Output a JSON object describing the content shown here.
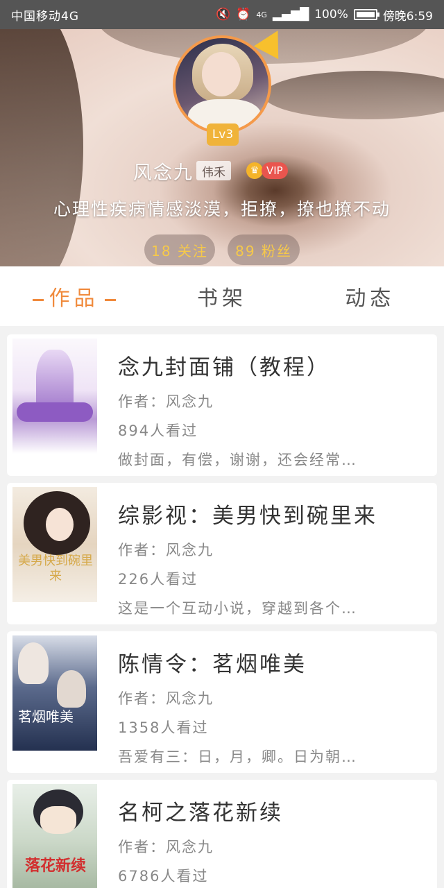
{
  "status_bar": {
    "carrier": "中国移动4G",
    "signal_label": "4G",
    "battery_text": "100%",
    "battery_level": 1.0,
    "time": "傍晚6:59",
    "icons": [
      "mute-icon",
      "alarm-icon",
      "signal-icon",
      "battery-icon"
    ]
  },
  "profile": {
    "level": "Lv3",
    "username": "风念九",
    "tag": "伟禾",
    "vip_label": "VIP",
    "signature": "心理性疾病情感淡漠，拒撩，撩也撩不动",
    "following": "18 关注",
    "fans": "89 粉丝"
  },
  "tabs": [
    {
      "label": "作品",
      "active": true
    },
    {
      "label": "书架",
      "active": false
    },
    {
      "label": "动态",
      "active": false
    }
  ],
  "books": [
    {
      "title": "念九封面铺（教程）",
      "author": "作者：风念九",
      "views": "894人看过",
      "desc": "做封面，有偿，谢谢，还会经常…"
    },
    {
      "title": "综影视：美男快到碗里来",
      "author": "作者：风念九",
      "views": "226人看过",
      "desc": "这是一个互动小说，穿越到各个…",
      "cover_text": "美男快到碗里来"
    },
    {
      "title": "陈情令：茗烟唯美",
      "author": "作者：风念九",
      "views": "1358人看过",
      "desc": "吾爱有三：日，月，卿。日为朝…",
      "cover_text": "茗烟唯美"
    },
    {
      "title": "名柯之落花新续",
      "author": "作者：风念九",
      "views": "6786人看过",
      "desc": "",
      "cover_text": "落花新续"
    }
  ],
  "colors": {
    "accent": "#f08a3c",
    "stat_text": "#f6c94a",
    "vip": "#e9554e"
  }
}
